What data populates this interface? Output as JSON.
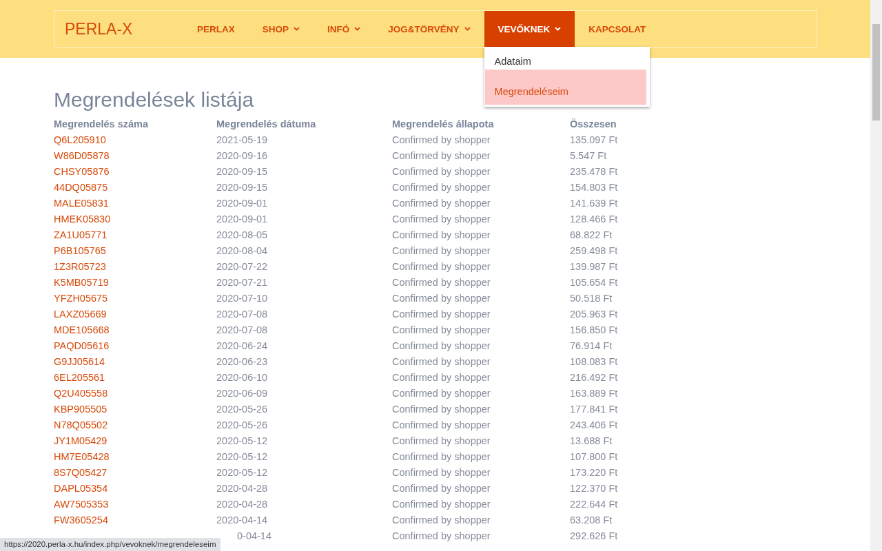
{
  "header": {
    "logo": "PERLA-X",
    "nav": [
      {
        "label": "PERLAX",
        "has_dropdown": false,
        "selected": false
      },
      {
        "label": "SHOP",
        "has_dropdown": true,
        "selected": false
      },
      {
        "label": "INFÓ",
        "has_dropdown": true,
        "selected": false
      },
      {
        "label": "JOG&TÖRVÉNY",
        "has_dropdown": true,
        "selected": false
      },
      {
        "label": "VEVŐKNEK",
        "has_dropdown": true,
        "selected": true
      },
      {
        "label": "KAPCSOLAT",
        "has_dropdown": false,
        "selected": false
      }
    ],
    "dropdown": [
      {
        "label": "Adataim",
        "selected": false
      },
      {
        "label": "Megrendeléseim",
        "selected": true
      }
    ]
  },
  "page_title": "Megrendelések listája",
  "table": {
    "columns": [
      "Megrendelés száma",
      "Megrendelés dátuma",
      "Megrendelés állapota",
      "Összesen"
    ],
    "rows": [
      [
        "Q6L205910",
        "2021-05-19",
        "Confirmed by shopper",
        "135.097 Ft"
      ],
      [
        "W86D05878",
        "2020-09-16",
        "Confirmed by shopper",
        "5.547 Ft"
      ],
      [
        "CHSY05876",
        "2020-09-15",
        "Confirmed by shopper",
        "235.478 Ft"
      ],
      [
        "44DQ05875",
        "2020-09-15",
        "Confirmed by shopper",
        "154.803 Ft"
      ],
      [
        "MALE05831",
        "2020-09-01",
        "Confirmed by shopper",
        "141.639 Ft"
      ],
      [
        "HMEK05830",
        "2020-09-01",
        "Confirmed by shopper",
        "128.466 Ft"
      ],
      [
        "ZA1U05771",
        "2020-08-05",
        "Confirmed by shopper",
        "68.822 Ft"
      ],
      [
        "P6B105765",
        "2020-08-04",
        "Confirmed by shopper",
        "259.498 Ft"
      ],
      [
        "1Z3R05723",
        "2020-07-22",
        "Confirmed by shopper",
        "139.987 Ft"
      ],
      [
        "K5MB05719",
        "2020-07-21",
        "Confirmed by shopper",
        "105.654 Ft"
      ],
      [
        "YFZH05675",
        "2020-07-10",
        "Confirmed by shopper",
        "50.518 Ft"
      ],
      [
        "LAXZ05669",
        "2020-07-08",
        "Confirmed by shopper",
        "205.963 Ft"
      ],
      [
        "MDE105668",
        "2020-07-08",
        "Confirmed by shopper",
        "156.850 Ft"
      ],
      [
        "PAQD05616",
        "2020-06-24",
        "Confirmed by shopper",
        "76.914 Ft"
      ],
      [
        "G9JJ05614",
        "2020-06-23",
        "Confirmed by shopper",
        "108.083 Ft"
      ],
      [
        "6EL205561",
        "2020-06-10",
        "Confirmed by shopper",
        "216.492 Ft"
      ],
      [
        "Q2U405558",
        "2020-06-09",
        "Confirmed by shopper",
        "163.889 Ft"
      ],
      [
        "KBP905505",
        "2020-05-26",
        "Confirmed by shopper",
        "177.841 Ft"
      ],
      [
        "N78Q05502",
        "2020-05-26",
        "Confirmed by shopper",
        "243.406 Ft"
      ],
      [
        "JY1M05429",
        "2020-05-12",
        "Confirmed by shopper",
        "13.688 Ft"
      ],
      [
        "HM7E05428",
        "2020-05-12",
        "Confirmed by shopper",
        "107.800 Ft"
      ],
      [
        "8S7Q05427",
        "2020-05-12",
        "Confirmed by shopper",
        "173.220 Ft"
      ],
      [
        "DAPL05354",
        "2020-04-28",
        "Confirmed by shopper",
        "122.370 Ft"
      ],
      [
        "AW7505353",
        "2020-04-28",
        "Confirmed by shopper",
        "222.644 Ft"
      ],
      [
        "FW3605254",
        "2020-04-14",
        "Confirmed by shopper",
        "63.208 Ft"
      ],
      [
        null,
        "0-04-14",
        "Confirmed by shopper",
        "292.626 Ft"
      ]
    ]
  },
  "status_bar": "https://2020.perla-x.hu/index.php/vevoknek/megrendeleseim"
}
